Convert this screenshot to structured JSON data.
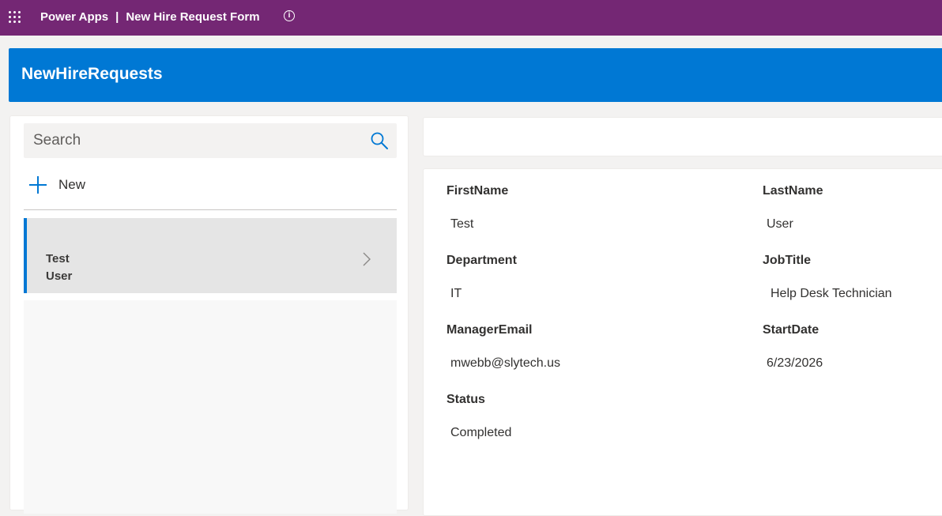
{
  "topbar": {
    "app_name": "Power Apps",
    "separator": "|",
    "form_name": "New Hire Request Form",
    "waffle_icon": "waffle-icon",
    "info_icon": "info-icon",
    "info_glyph": "i",
    "background": "#742774"
  },
  "header": {
    "title": "NewHireRequests",
    "background": "#0078d4"
  },
  "left": {
    "search": {
      "placeholder": "Search",
      "value": "",
      "icon": "search-icon"
    },
    "new_button": {
      "label": "New",
      "icon": "plus-icon"
    },
    "items": [
      {
        "line1": "Test",
        "line2": "User",
        "selected": true,
        "icon": "chevron-right-icon"
      }
    ]
  },
  "form": {
    "fields": [
      {
        "label": "FirstName",
        "value": "Test"
      },
      {
        "label": "LastName",
        "value": "User"
      },
      {
        "label": "Department",
        "value": "IT"
      },
      {
        "label": "JobTitle",
        "value": "Help Desk Technician"
      },
      {
        "label": "ManagerEmail",
        "value": "mwebb@slytech.us"
      },
      {
        "label": "StartDate",
        "value": "6/23/2026"
      },
      {
        "label": "Status",
        "value": "Completed"
      }
    ]
  }
}
